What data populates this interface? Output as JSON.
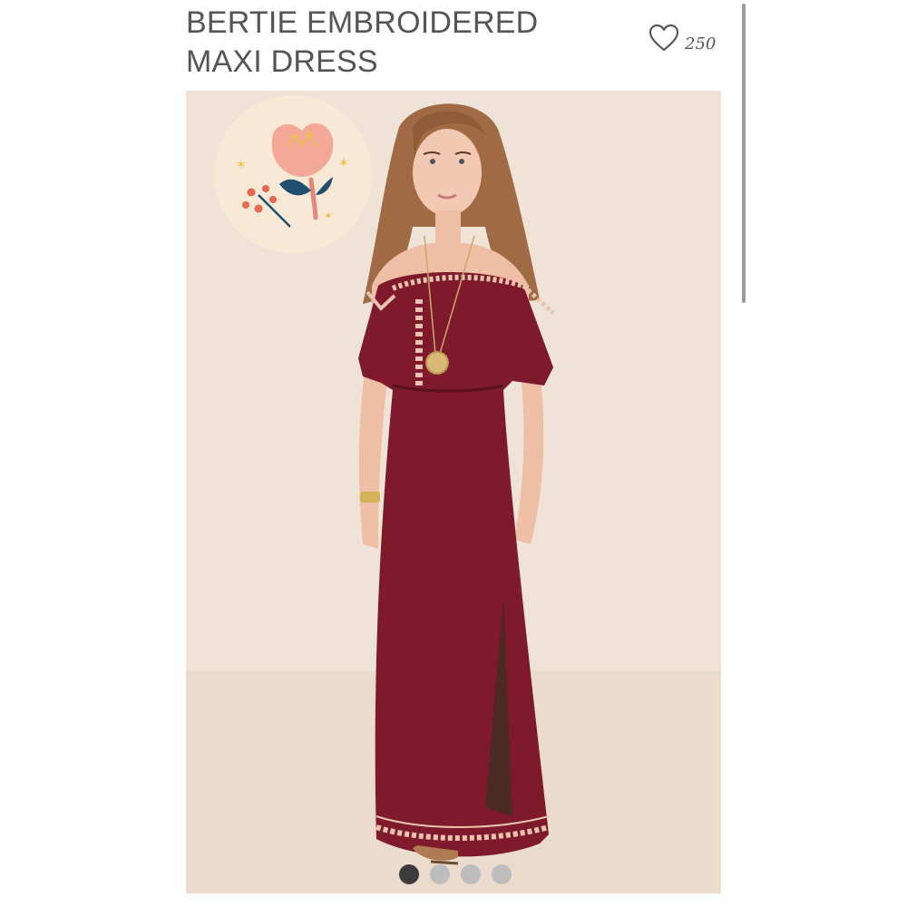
{
  "product": {
    "title_line1": "BERTIE EMBROIDERED",
    "title_line2": "MAXI DRESS",
    "favorite_count": "250",
    "favorite_icon": "heart-outline-icon"
  },
  "gallery": {
    "image_count": 4,
    "active_index": 0,
    "badge_icon": "flower-illustration-icon"
  },
  "colors": {
    "photo_background": "#efe3d8",
    "dress": "#7e1a2b",
    "badge_background": "#f7e9d5",
    "active_dot": "#3b3b3b",
    "inactive_dot": "#bdbdbd"
  }
}
